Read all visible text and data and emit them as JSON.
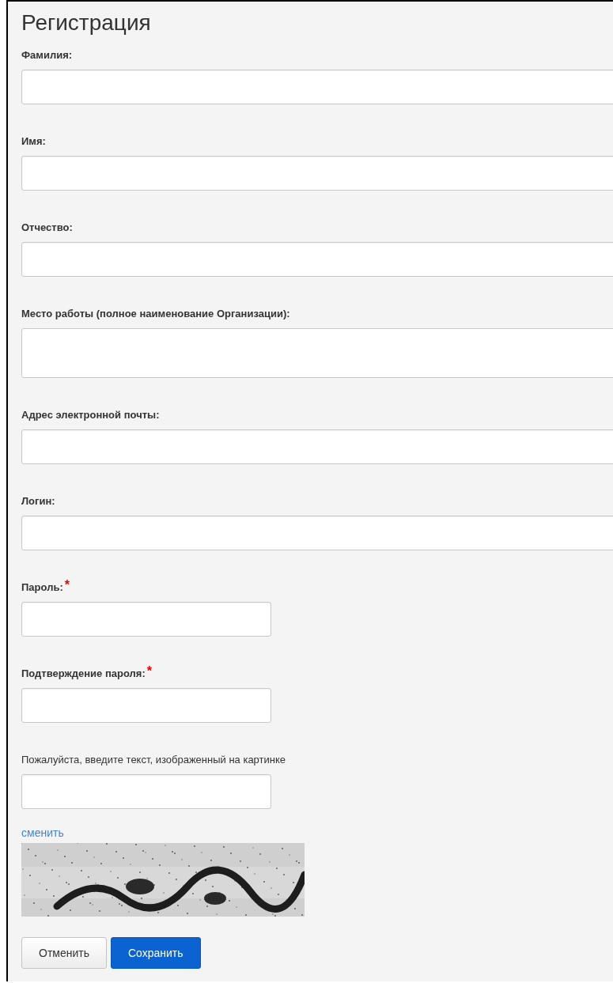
{
  "title": "Регистрация",
  "required_mark": "*",
  "fields": [
    {
      "label": "Фамилия:",
      "kind": "text",
      "required": false
    },
    {
      "label": "Имя:",
      "kind": "text",
      "required": false
    },
    {
      "label": "Отчество:",
      "kind": "text",
      "required": false
    },
    {
      "label": "Место работы (полное наименование Организации):",
      "kind": "textarea",
      "required": false
    },
    {
      "label": "Адрес электронной почты:",
      "kind": "text",
      "required": false
    },
    {
      "label": "Логин:",
      "kind": "text",
      "required": false
    },
    {
      "label": "Пароль:",
      "kind": "short",
      "required": true
    },
    {
      "label": "Подтверждение пароля:",
      "kind": "short",
      "required": true
    }
  ],
  "captcha": {
    "prompt": "Пожалуйста, введите текст, изображенный на картинке",
    "change_link": "сменить"
  },
  "buttons": [
    {
      "label": "Отменить",
      "kind": "default"
    },
    {
      "label": "Сохранить",
      "kind": "primary"
    }
  ]
}
